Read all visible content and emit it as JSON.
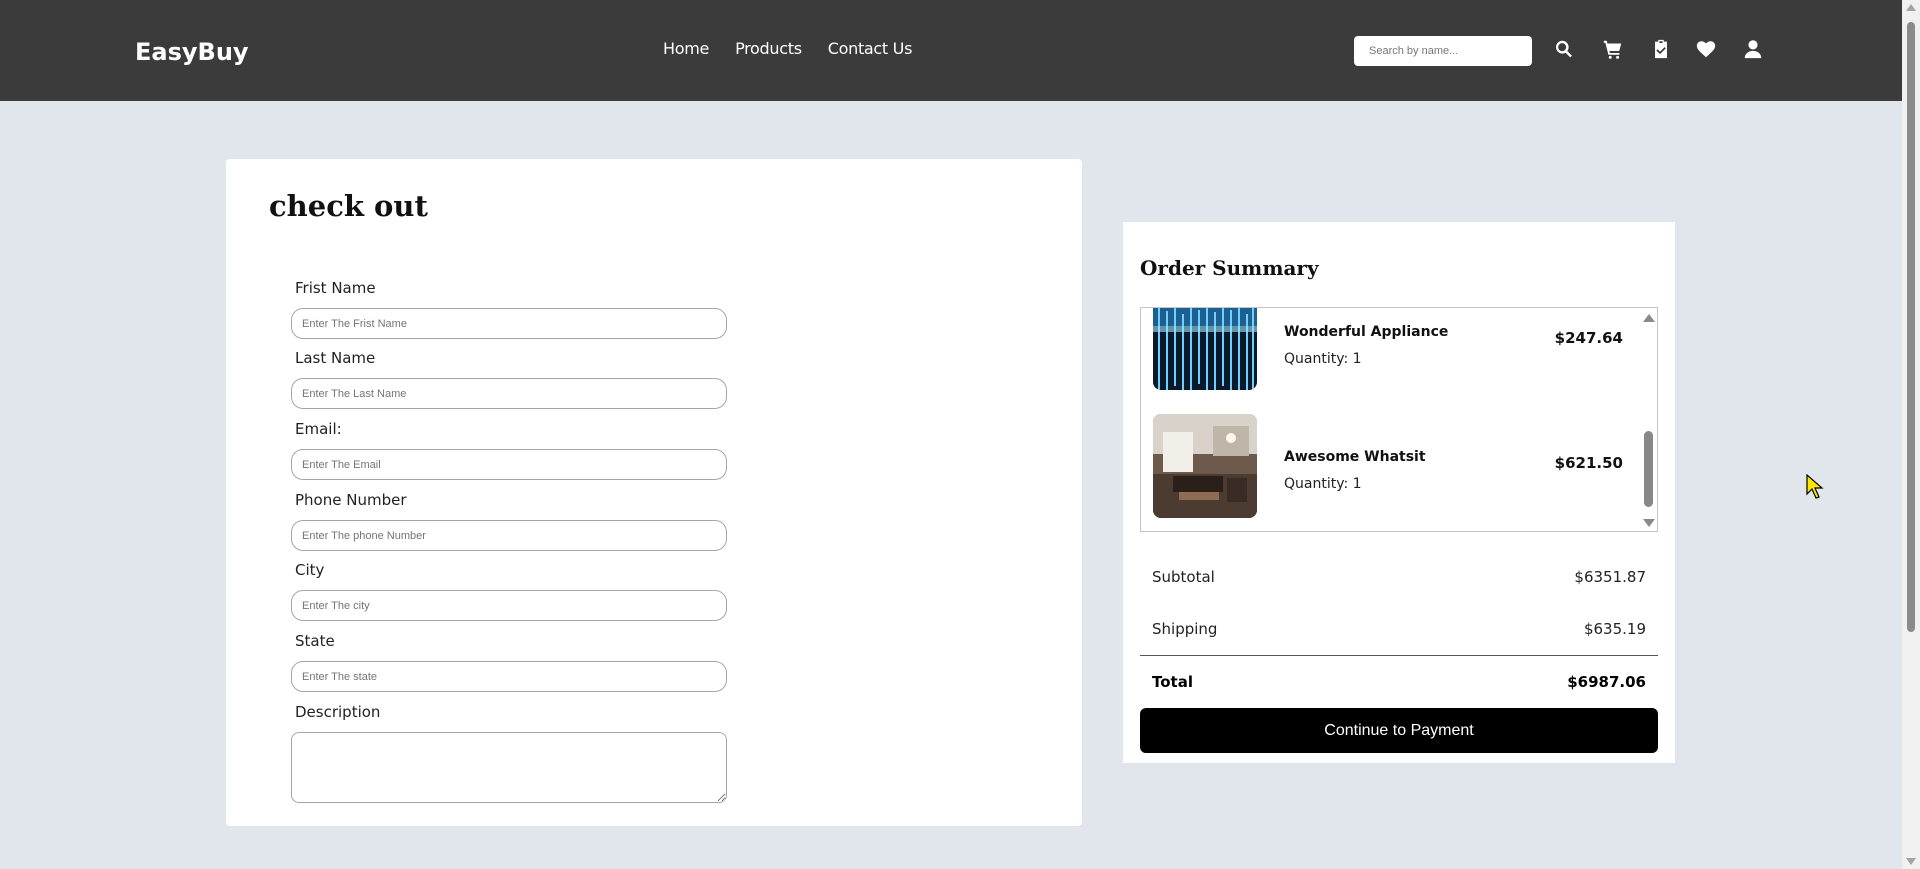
{
  "header": {
    "brand": "EasyBuy",
    "nav": [
      "Home",
      "Products",
      "Contact Us"
    ],
    "search_placeholder": "Search by name...",
    "icons": [
      "search-icon",
      "cart-icon",
      "clipboard-check-icon",
      "heart-icon",
      "user-icon"
    ]
  },
  "checkout": {
    "title": "check out",
    "fields": {
      "first_name": {
        "label": "Frist Name",
        "placeholder": "Enter The Frist Name"
      },
      "last_name": {
        "label": "Last Name",
        "placeholder": "Enter The Last Name"
      },
      "email": {
        "label": "Email:",
        "placeholder": "Enter The Email"
      },
      "phone": {
        "label": "Phone Number",
        "placeholder": "Enter The phone Number"
      },
      "city": {
        "label": "City",
        "placeholder": "Enter The city"
      },
      "state": {
        "label": "State",
        "placeholder": "Enter The state"
      },
      "description": {
        "label": "Description"
      }
    }
  },
  "summary": {
    "title": "Order Summary",
    "items": [
      {
        "name": "Wonderful Appliance",
        "quantity": "Quantity: 1",
        "price": "$247.64"
      },
      {
        "name": "Awesome Whatsit",
        "quantity": "Quantity: 1",
        "price": "$621.50"
      }
    ],
    "subtotal_label": "Subtotal",
    "subtotal_value": "$6351.87",
    "shipping_label": "Shipping",
    "shipping_value": "$635.19",
    "total_label": "Total",
    "total_value": "$6987.06",
    "pay_button": "Continue to Payment"
  },
  "colors": {
    "header_bg": "#3b3b3b",
    "page_bg": "#e1e5ec",
    "button_bg": "#000000"
  }
}
